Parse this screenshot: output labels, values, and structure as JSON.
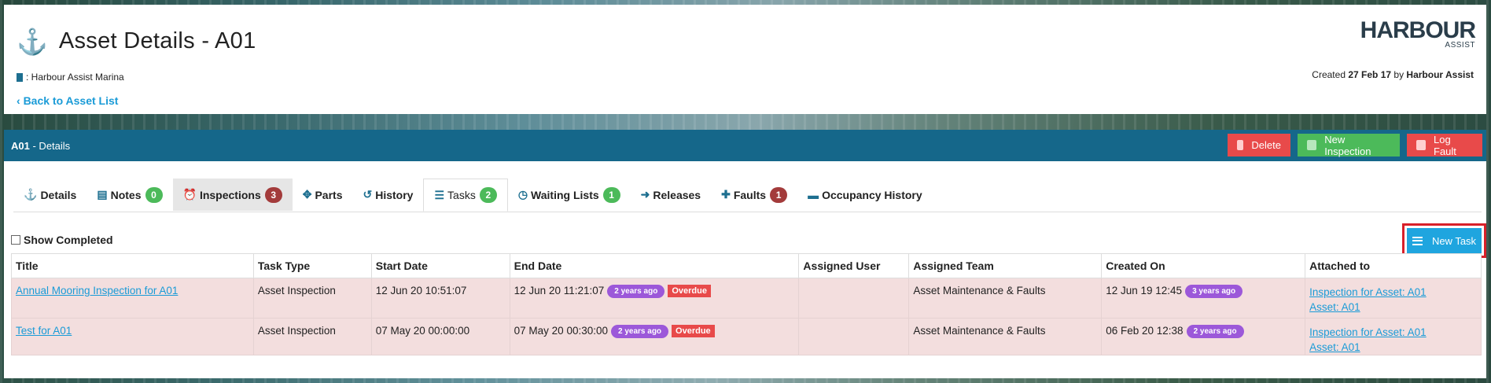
{
  "header": {
    "title": "Asset Details - A01",
    "marina": ": Harbour Assist Marina",
    "back_label": "Back to Asset List",
    "logo_big": "HARBOUR",
    "logo_small": "ASSIST",
    "created_prefix": "Created",
    "created_date": "27 Feb 17",
    "created_by_word": "by",
    "created_by": "Harbour Assist"
  },
  "panel": {
    "asset_id": "A01",
    "title_suffix": "- Details",
    "buttons": {
      "delete": "Delete",
      "new_inspection": "New Inspection",
      "log_fault": "Log Fault"
    }
  },
  "tabs": [
    {
      "label": "Details",
      "icon": "anchor-icon",
      "badge": null
    },
    {
      "label": "Notes",
      "icon": "file-icon",
      "badge": "0"
    },
    {
      "label": "Inspections",
      "icon": "alarm-clock-icon",
      "badge": "3"
    },
    {
      "label": "Parts",
      "icon": "puzzle-icon",
      "badge": null
    },
    {
      "label": "History",
      "icon": "history-icon",
      "badge": null
    },
    {
      "label": "Tasks",
      "icon": "tasks-icon",
      "badge": "2"
    },
    {
      "label": "Waiting Lists",
      "icon": "clock-icon",
      "badge": "1"
    },
    {
      "label": "Releases",
      "icon": "sign-out-icon",
      "badge": null
    },
    {
      "label": "Faults",
      "icon": "first-aid-icon",
      "badge": "1"
    },
    {
      "label": "Occupancy History",
      "icon": "bed-icon",
      "badge": null
    }
  ],
  "show_completed": "Show Completed",
  "new_task": "New Task",
  "table": {
    "headers": [
      "Title",
      "Task Type",
      "Start Date",
      "End Date",
      "Assigned User",
      "Assigned Team",
      "Created On",
      "Attached to"
    ],
    "rows": [
      {
        "title": "Annual Mooring Inspection for A01",
        "task_type": "Asset Inspection",
        "start_date": "12 Jun 20 10:51:07",
        "end_date": "12 Jun 20 11:21:07",
        "end_pill": "2 years ago",
        "overdue": "Overdue",
        "assigned_user": "",
        "assigned_team": "Asset Maintenance & Faults",
        "created_on": "12 Jun 19 12:45",
        "created_pill": "3 years ago",
        "attached_1": "Inspection for Asset: A01",
        "attached_2": "Asset: A01"
      },
      {
        "title": "Test for A01",
        "task_type": "Asset Inspection",
        "start_date": "07 May 20 00:00:00",
        "end_date": "07 May 20 00:30:00",
        "end_pill": "2 years ago",
        "overdue": "Overdue",
        "assigned_user": "",
        "assigned_team": "Asset Maintenance & Faults",
        "created_on": "06 Feb 20 12:38",
        "created_pill": "2 years ago",
        "attached_1": "Inspection for Asset: A01",
        "attached_2": "Asset: A01"
      }
    ]
  },
  "colors": {
    "primary": "#15678a",
    "link": "#1a9bd7",
    "danger": "#e84a4a",
    "success": "#4cba5a",
    "pill": "#9c58d9",
    "row_bg": "#f3dede",
    "highlight_border": "#d8202a"
  }
}
